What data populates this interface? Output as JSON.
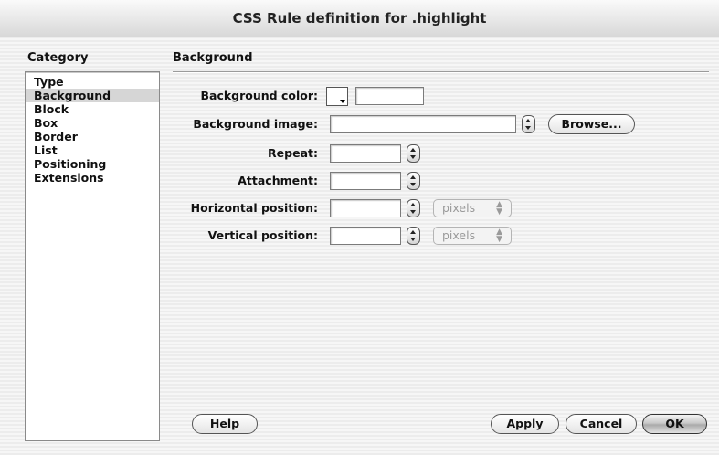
{
  "window": {
    "title": "CSS Rule definition for .highlight"
  },
  "category": {
    "heading": "Category",
    "items": [
      "Type",
      "Background",
      "Block",
      "Box",
      "Border",
      "List",
      "Positioning",
      "Extensions"
    ],
    "selected": "Background"
  },
  "panel": {
    "heading": "Background",
    "background_color": {
      "label": "Background color:",
      "value": ""
    },
    "background_image": {
      "label": "Background image:",
      "value": "",
      "browse_label": "Browse..."
    },
    "repeat": {
      "label": "Repeat:",
      "value": ""
    },
    "attachment": {
      "label": "Attachment:",
      "value": ""
    },
    "horizontal_position": {
      "label": "Horizontal position:",
      "value": "",
      "unit": "pixels"
    },
    "vertical_position": {
      "label": "Vertical position:",
      "value": "",
      "unit": "pixels"
    }
  },
  "buttons": {
    "help": "Help",
    "apply": "Apply",
    "cancel": "Cancel",
    "ok": "OK"
  }
}
